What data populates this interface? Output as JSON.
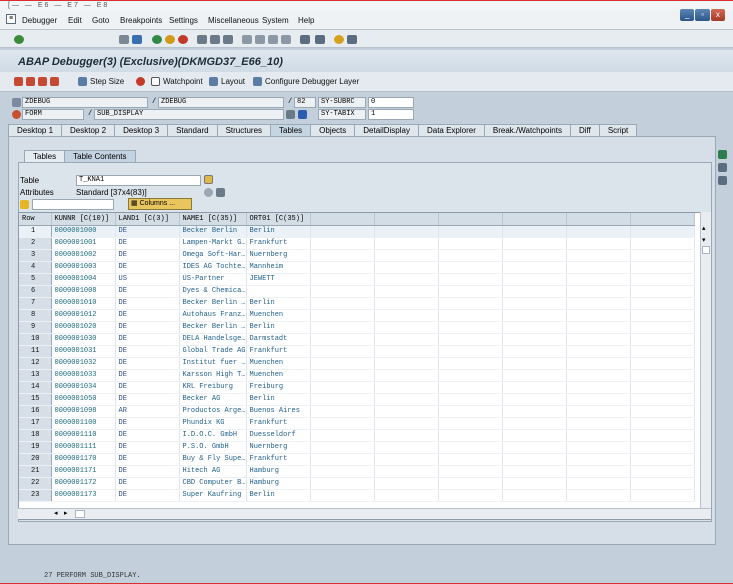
{
  "top_remnant": "[— —  E6   —  E7   —  E8",
  "menu": [
    "Debugger",
    "Edit",
    "Goto",
    "Breakpoints",
    "Settings",
    "Miscellaneous",
    "System",
    "Help"
  ],
  "window_buttons": [
    "_",
    "▫",
    "x"
  ],
  "title": "ABAP Debugger(3)  (Exclusive)(DKMGD37_E66_10)",
  "toolbar2": {
    "step_size": "Step Size",
    "watchpoint": "Watchpoint",
    "layout": "Layout",
    "configure": "Configure Debugger Layer"
  },
  "context": {
    "row1": {
      "program": "ZDEBUG",
      "include": "ZDEBUG",
      "line": "82",
      "sysfield": "SY-SUBRC",
      "sysval": "0"
    },
    "row2": {
      "type": "FORM",
      "name": "SUB_DISPLAY",
      "sysfield": "SY-TABIX",
      "sysval": "1"
    }
  },
  "tabs": [
    "Desktop 1",
    "Desktop 2",
    "Desktop 3",
    "Standard",
    "Structures",
    "Tables",
    "Objects",
    "DetailDisplay",
    "Data Explorer",
    "Break./Watchpoints",
    "Diff",
    "Script"
  ],
  "active_tab": "Tables",
  "subtabs": [
    "Tables",
    "Table Contents"
  ],
  "table_label": "Table",
  "table_name": "T_KNA1",
  "attributes_label": "Attributes",
  "attributes_value": "Standard [37x4(83)]",
  "columns_button": "Columns ...",
  "grid": {
    "headers": [
      "Row",
      "KUNNR [C(10)]",
      "LAND1 [C(3)]",
      "NAME1 [C(35)]",
      "ORT01 [C(35)]"
    ],
    "rows": [
      [
        "1",
        "0000001000",
        "DE",
        "Becker Berlin",
        "Berlin"
      ],
      [
        "2",
        "0000001001",
        "DE",
        "Lampen-Markt G…",
        "Frankfurt"
      ],
      [
        "3",
        "0000001002",
        "DE",
        "Omega Soft-Har…",
        "Nuernberg"
      ],
      [
        "4",
        "0000001003",
        "DE",
        "IDES AG Tochte…",
        "Mannheim"
      ],
      [
        "5",
        "0000001004",
        "US",
        "US-Partner",
        "JEWETT"
      ],
      [
        "6",
        "0000001008",
        "DE",
        "Dyes & Chemica…",
        ""
      ],
      [
        "7",
        "0000001010",
        "DE",
        "Becker Berlin …",
        "Berlin"
      ],
      [
        "8",
        "0000001012",
        "DE",
        "Autohaus Franz…",
        "Muenchen"
      ],
      [
        "9",
        "0000001020",
        "DE",
        "Becker Berlin …",
        "Berlin"
      ],
      [
        "10",
        "0000001030",
        "DE",
        "DELA Handelsge…",
        "Darmstadt"
      ],
      [
        "11",
        "0000001031",
        "DE",
        "Global Trade AG",
        "Frankfurt"
      ],
      [
        "12",
        "0000001032",
        "DE",
        "Institut fuer …",
        "Muenchen"
      ],
      [
        "13",
        "0000001033",
        "DE",
        "Karsson High T…",
        "Muenchen"
      ],
      [
        "14",
        "0000001034",
        "DE",
        "KRL Freiburg",
        "Freiburg"
      ],
      [
        "15",
        "0000001050",
        "DE",
        "Becker AG",
        "Berlin"
      ],
      [
        "16",
        "0000001098",
        "AR",
        "Productos Arge…",
        "Buenos Aires"
      ],
      [
        "17",
        "0000001100",
        "DE",
        "Phundix KG",
        "Frankfurt"
      ],
      [
        "18",
        "0000001110",
        "DE",
        "I.D.O.C. GmbH",
        "Duesseldorf"
      ],
      [
        "19",
        "0000001111",
        "DE",
        "P.S.O. GmbH",
        "Nuernberg"
      ],
      [
        "20",
        "0000001170",
        "DE",
        "Buy & Fly Supe…",
        "Frankfurt"
      ],
      [
        "21",
        "0000001171",
        "DE",
        "Hitech AG",
        "Hamburg"
      ],
      [
        "22",
        "0000001172",
        "DE",
        "CBD Computer B…",
        "Hamburg"
      ],
      [
        "23",
        "0000001173",
        "DE",
        "Super Kaufring",
        "Berlin"
      ]
    ]
  },
  "bottom_line": "27    PERFORM SUB_DISPLAY."
}
